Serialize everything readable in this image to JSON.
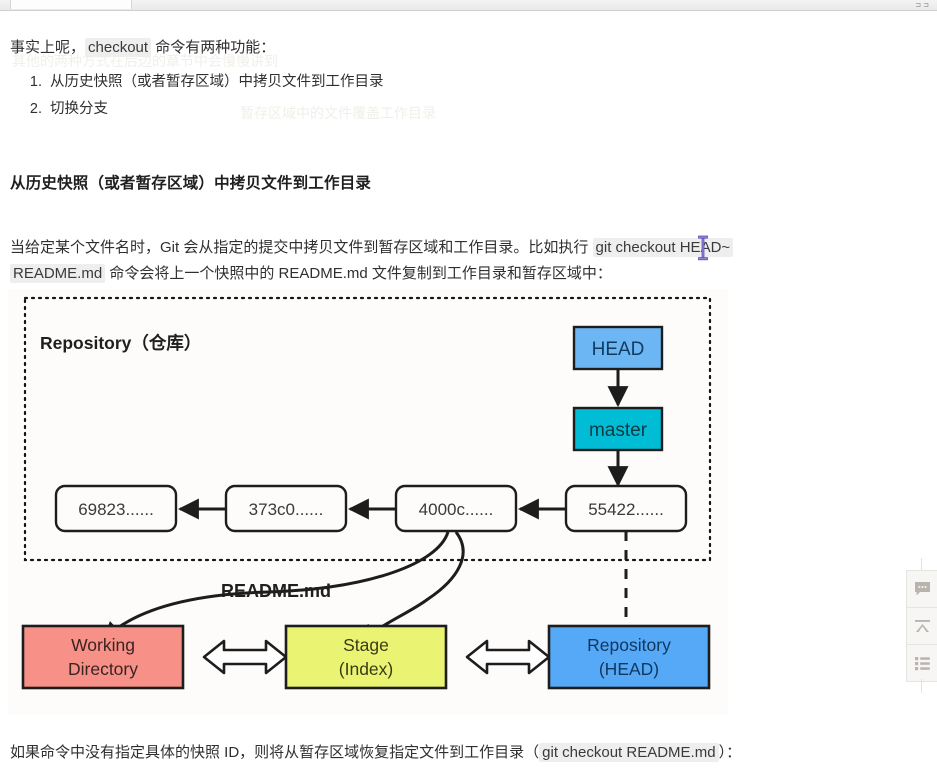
{
  "window": {
    "controls_glyph": "⊐⊐"
  },
  "article": {
    "intro": {
      "before": "事实上呢，",
      "code": "checkout",
      "after": " 命令有两种功能："
    },
    "features": [
      "从历史快照（或者暂存区域）中拷贝文件到工作目录",
      "切换分支"
    ],
    "heading": "从历史快照（或者暂存区域）中拷贝文件到工作目录",
    "body": {
      "line1_before": "当给定某个文件名时，Git 会从指定的提交中拷贝文件到暂存区域和工作目录。比如执行 ",
      "line1_code": "git checkout HEAD~",
      "line2_code": "README.md",
      "line2_after": " 命令会将上一个快照中的 README.md 文件复制到工作目录和暂存区域中："
    },
    "footer": {
      "before": "如果命令中没有指定具体的快照 ID，则将从暂存区域恢复指定文件到工作目录（",
      "code": "git checkout README.md",
      "after": "）："
    },
    "ghost_lines": [
      "其他的两种方式在后边的章节中会慢慢讲到",
      "暂存区域中的文件覆盖工作目录"
    ]
  },
  "diagram": {
    "repository_label": "Repository（仓库）",
    "refs": [
      {
        "name": "HEAD",
        "fill": "#6cb7f3",
        "text": "#123a5e"
      },
      {
        "name": "master",
        "fill": "#00bcd4",
        "text": "#0c3b43"
      }
    ],
    "commits": [
      "69823......",
      "373c0......",
      "4000c......",
      "55422......"
    ],
    "edge_label": "README.md",
    "areas": [
      {
        "title": "Working",
        "subtitle": "Directory",
        "fill": "#f79087",
        "text": "#3a2422"
      },
      {
        "title": "Stage",
        "subtitle": "(Index)",
        "fill": "#eaf472",
        "text": "#3a3a18"
      },
      {
        "title": "Repository",
        "subtitle": "(HEAD)",
        "fill": "#56a9f7",
        "text": "#10375e"
      }
    ],
    "colors": {
      "stroke": "#1d1d1d",
      "box_fill": "#fdfcfa",
      "dotted_border": "#141414",
      "canvas": "#fdfcfa"
    }
  },
  "side_toolbar": {
    "buttons": [
      {
        "name": "comment",
        "label": "评论"
      },
      {
        "name": "back-to-top",
        "label": "回到顶部"
      },
      {
        "name": "catalog",
        "label": "目录"
      }
    ]
  }
}
